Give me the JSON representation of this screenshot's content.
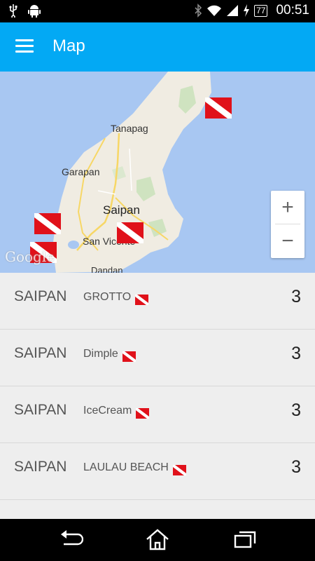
{
  "status_bar": {
    "battery": "77",
    "time": "00:51"
  },
  "app_bar": {
    "title": "Map"
  },
  "map": {
    "labels": {
      "tanapag": "Tanapag",
      "garapan": "Garapan",
      "saipan": "Saipan",
      "san_vicente": "San Vicente",
      "dandan": "Dandan"
    },
    "zoom_in": "+",
    "zoom_out": "−",
    "attribution": "Google"
  },
  "dive_sites": [
    {
      "region": "SAIPAN",
      "site": "GROTTO",
      "count": "3"
    },
    {
      "region": "SAIPAN",
      "site": "Dimple",
      "count": "3"
    },
    {
      "region": "SAIPAN",
      "site": "IceCream",
      "count": "3"
    },
    {
      "region": "SAIPAN",
      "site": "LAULAU BEACH",
      "count": "3"
    }
  ],
  "colors": {
    "app_bar": "#03a9f4",
    "dive_flag_red": "#e0111a",
    "water": "#a8c7f2",
    "land": "#f0ece2"
  }
}
